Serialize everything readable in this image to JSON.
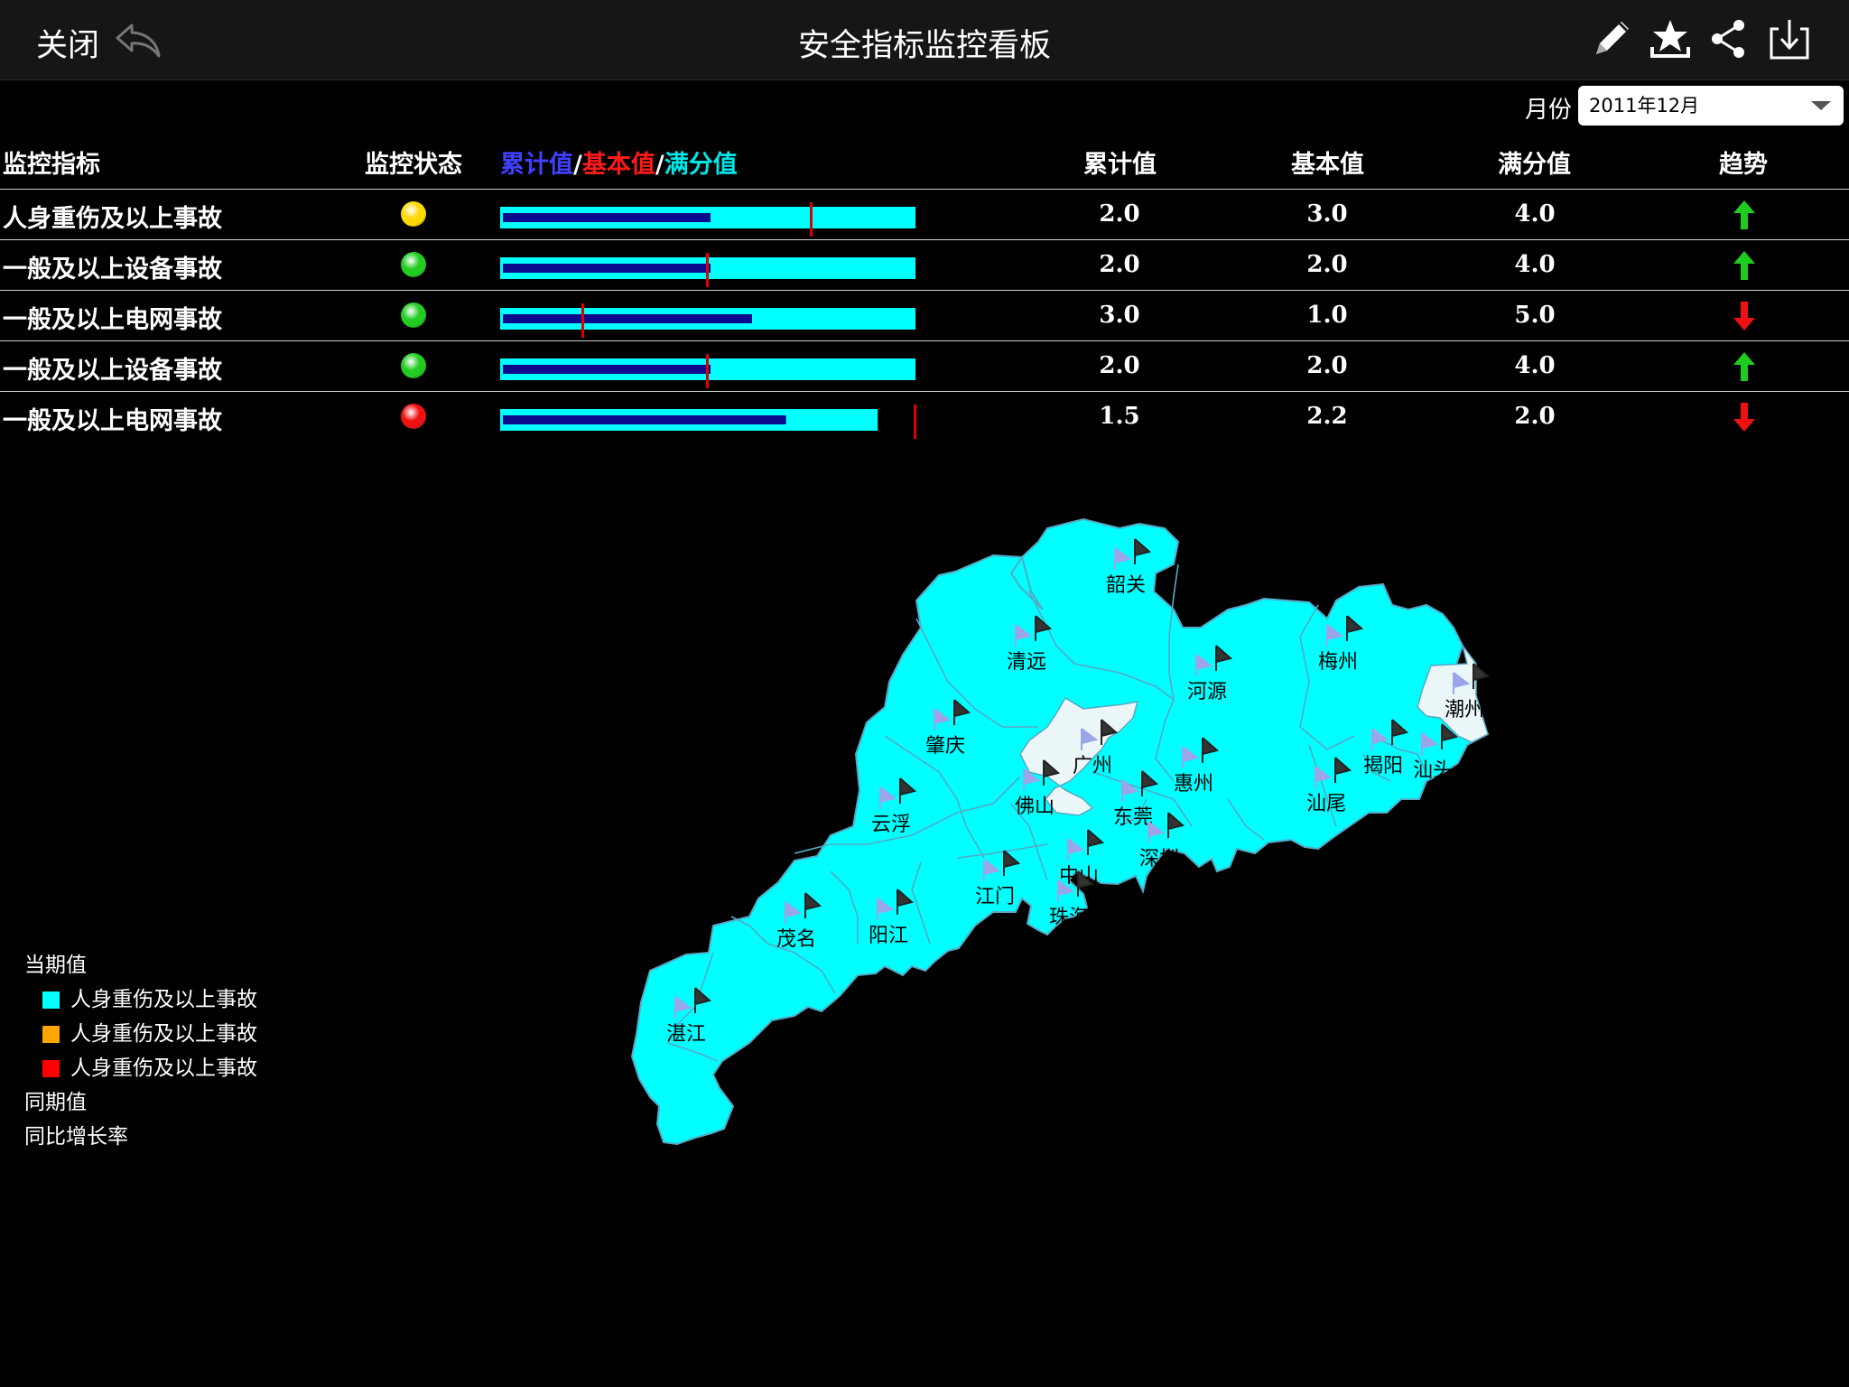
{
  "topbar": {
    "close_label": "关闭",
    "title": "安全指标监控看板",
    "icons": [
      "back-icon",
      "pencil-icon",
      "star-icon",
      "share-icon",
      "download-icon"
    ]
  },
  "filter": {
    "month_label": "月份",
    "month_value": "2011年12月"
  },
  "table": {
    "headers": {
      "metric": "监控指标",
      "status": "监控状态",
      "bar_cumulative": "累计值",
      "bar_sep": "/",
      "bar_basic": "基本值",
      "bar_full": "满分值",
      "cumulative": "累计值",
      "basic": "基本值",
      "full": "满分值",
      "trend": "趋势"
    },
    "rows": [
      {
        "metric": "人身重伤及以上事故",
        "status": "yellow",
        "cumulative": "2.0",
        "basic": "3.0",
        "full": "4.0",
        "trend": "up"
      },
      {
        "metric": "一般及以上设备事故",
        "status": "green",
        "cumulative": "2.0",
        "basic": "2.0",
        "full": "4.0",
        "trend": "up"
      },
      {
        "metric": "一般及以上电网事故",
        "status": "green",
        "cumulative": "3.0",
        "basic": "1.0",
        "full": "5.0",
        "trend": "down"
      },
      {
        "metric": "一般及以上设备事故",
        "status": "green",
        "cumulative": "2.0",
        "basic": "2.0",
        "full": "4.0",
        "trend": "up"
      },
      {
        "metric": "一般及以上电网事故",
        "status": "red",
        "cumulative": "1.5",
        "basic": "2.2",
        "full": "2.0",
        "trend": "down"
      }
    ]
  },
  "colors": {
    "bar_full": "#00ffff",
    "bar_cumulative": "#0a0a8c",
    "bar_basic": "#e00000",
    "hdr_cumulative": "#4040ff",
    "hdr_basic": "#ff1a1a",
    "hdr_full": "#00e5e5",
    "status_yellow": "#ffd800",
    "status_green": "#22cc22",
    "status_red": "#ee1111",
    "trend_up": "#1fcc1f",
    "trend_down": "#ee1111",
    "map_fill": "#00ffff",
    "map_highlight": "#eaf6f8",
    "map_border": "#5ab0c8"
  },
  "map": {
    "cities": [
      {
        "name": "韶关",
        "highlight": false
      },
      {
        "name": "清远",
        "highlight": false
      },
      {
        "name": "河源",
        "highlight": false
      },
      {
        "name": "梅州",
        "highlight": false
      },
      {
        "name": "潮州",
        "highlight": true
      },
      {
        "name": "肇庆",
        "highlight": false
      },
      {
        "name": "广州",
        "highlight": true
      },
      {
        "name": "惠州",
        "highlight": false
      },
      {
        "name": "揭阳",
        "highlight": false
      },
      {
        "name": "汕头",
        "highlight": false
      },
      {
        "name": "佛山",
        "highlight": false
      },
      {
        "name": "东莞",
        "highlight": false
      },
      {
        "name": "汕尾",
        "highlight": false
      },
      {
        "name": "云浮",
        "highlight": false
      },
      {
        "name": "深圳",
        "highlight": false
      },
      {
        "name": "中山",
        "highlight": false
      },
      {
        "name": "江门",
        "highlight": false
      },
      {
        "name": "珠海",
        "highlight": false
      },
      {
        "name": "茂名",
        "highlight": false
      },
      {
        "name": "阳江",
        "highlight": false
      },
      {
        "name": "湛江",
        "highlight": false
      }
    ]
  },
  "legend": {
    "current_title": "当期值",
    "items": [
      {
        "label": "人身重伤及以上事故",
        "color": "#00ffff"
      },
      {
        "label": "人身重伤及以上事故",
        "color": "#ffa500"
      },
      {
        "label": "人身重伤及以上事故",
        "color": "#ff0000"
      }
    ],
    "same_period": "同期值",
    "yoy_growth": "同比增长率"
  }
}
